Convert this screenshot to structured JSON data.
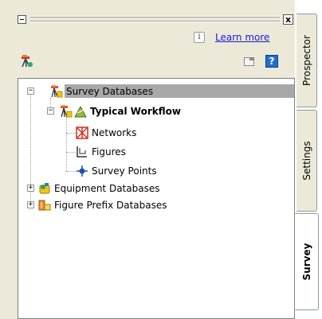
{
  "palette": {
    "close_label": "x",
    "info_icon_glyph": "i",
    "learn_more": "Learn more",
    "help_glyph": "?"
  },
  "tree": {
    "root": {
      "label": "Survey Databases"
    },
    "workflow": {
      "label": "Typical Workflow"
    },
    "children": [
      {
        "label": "Networks"
      },
      {
        "label": "Figures"
      },
      {
        "label": "Survey Points"
      }
    ],
    "equipment": {
      "label": "Equipment Databases"
    },
    "prefix": {
      "label": "Figure Prefix Databases"
    }
  },
  "tabs": [
    {
      "label": "Prospector"
    },
    {
      "label": "Settings"
    },
    {
      "label": "Survey"
    }
  ],
  "colors": {
    "selection": "#a8a8a8",
    "link": "#1a1ad8",
    "help_blue": "#1f6fcf"
  }
}
